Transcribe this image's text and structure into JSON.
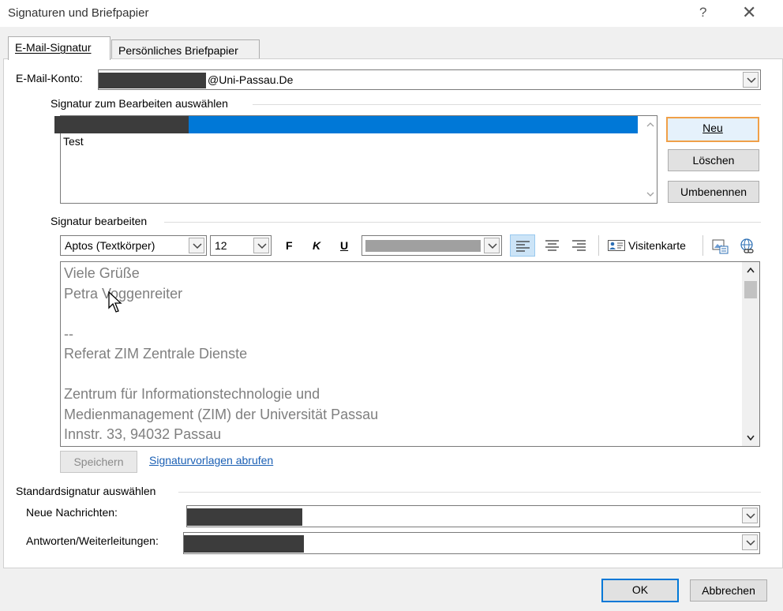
{
  "window": {
    "title": "Signaturen und Briefpapier",
    "help_glyph": "?",
    "close_glyph": "✕"
  },
  "tabs": [
    {
      "label": "E-Mail-Signatur",
      "active": true
    },
    {
      "label": "Persönliches Briefpapier",
      "active": false
    }
  ],
  "account": {
    "label": "E-Mail-Konto:",
    "value_suffix": "@Uni-Passau.De"
  },
  "select_signature": {
    "group_label": "Signatur zum Bearbeiten auswählen",
    "items": [
      "Test"
    ]
  },
  "buttons": {
    "new": "Neu",
    "delete": "Löschen",
    "rename": "Umbenennen",
    "save": "Speichern",
    "ok": "OK",
    "cancel": "Abbrechen"
  },
  "edit_signature": {
    "group_label": "Signatur bearbeiten",
    "font": "Aptos (Textkörper)",
    "size": "12",
    "bold": "F",
    "italic": "K",
    "underline": "U",
    "business_card": "Visitenkarte",
    "lines": [
      "Viele Grüße",
      "Petra Voggenreiter",
      "",
      "--",
      "Referat ZIM Zentrale Dienste",
      "",
      "Zentrum für Informationstechnologie und",
      "Medienmanagement (ZIM) der Universität Passau",
      "Innstr. 33, 94032 Passau"
    ]
  },
  "templates_link": "Signaturvorlagen abrufen",
  "default_signature": {
    "group_label": "Standardsignatur auswählen",
    "new_messages_label": "Neue Nachrichten:",
    "replies_label": "Antworten/Weiterleitungen:"
  },
  "colors": {
    "selection": "#0078d7",
    "focus_orange": "#f0a048",
    "link": "#1a5fb4"
  }
}
